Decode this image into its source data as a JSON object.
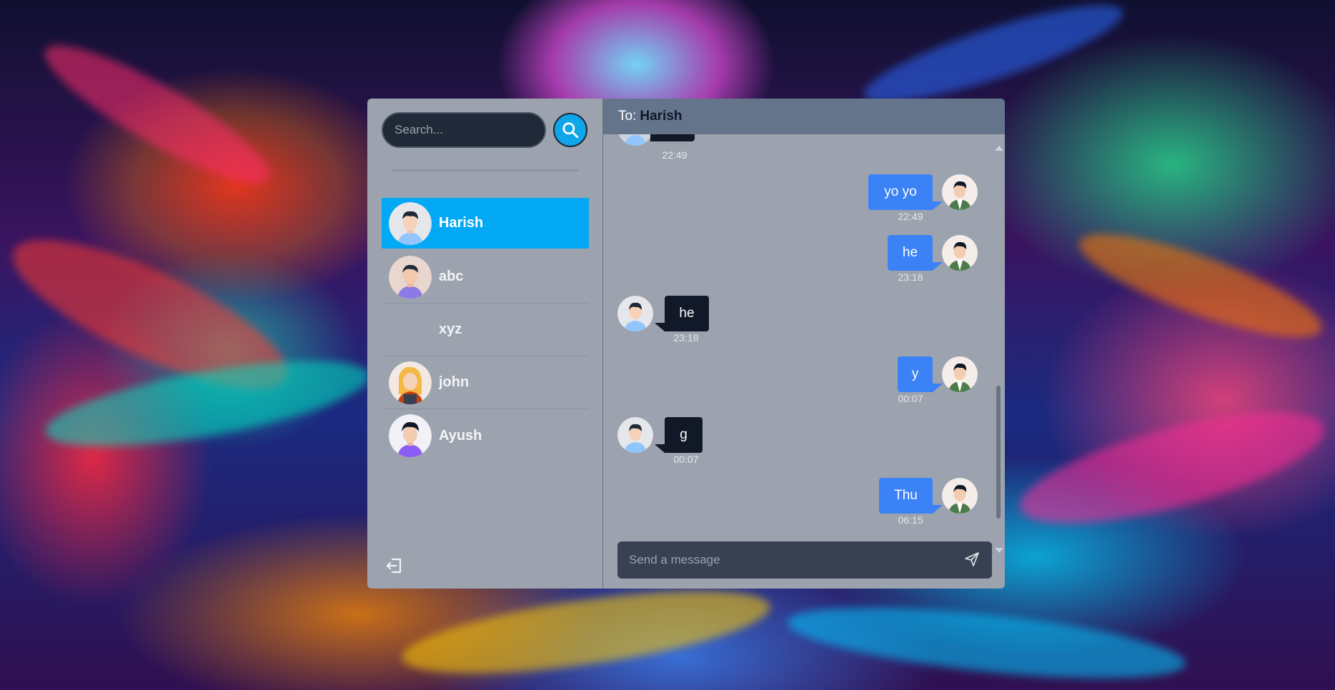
{
  "colors": {
    "sidebar_bg": "#9ca3af",
    "header_bg": "#64748b",
    "active_contact": "#03a9f4",
    "outgoing_bubble": "#3b82f6",
    "incoming_bubble": "#111827",
    "search_button": "#0ea5e9"
  },
  "sidebar": {
    "search": {
      "placeholder": "Search...",
      "value": "",
      "button_icon": "search-icon"
    },
    "contacts": [
      {
        "name": "Harish",
        "active": true,
        "avatar": "man-blue-shirt"
      },
      {
        "name": "abc",
        "active": false,
        "avatar": "man-purple-shirt"
      },
      {
        "name": "xyz",
        "active": false,
        "avatar": ""
      },
      {
        "name": "john",
        "active": false,
        "avatar": "woman-overalls"
      },
      {
        "name": "Ayush",
        "active": false,
        "avatar": "man-purple-shirt"
      }
    ],
    "logout_icon": "logout-icon"
  },
  "chat": {
    "header": {
      "prefix": "To:",
      "recipient": "Harish"
    },
    "messages": [
      {
        "direction": "in",
        "text": "",
        "time": "22:49",
        "partial": true
      },
      {
        "direction": "out",
        "text": "yo yo",
        "time": "22:49"
      },
      {
        "direction": "out",
        "text": "he",
        "time": "23:18"
      },
      {
        "direction": "in",
        "text": "he",
        "time": "23:18"
      },
      {
        "direction": "out",
        "text": "y",
        "time": "00:07"
      },
      {
        "direction": "in",
        "text": "g",
        "time": "00:07"
      },
      {
        "direction": "out",
        "text": "Thu",
        "time": "06:15"
      }
    ],
    "compose": {
      "placeholder": "Send a message",
      "value": "",
      "send_icon": "send-icon"
    }
  }
}
